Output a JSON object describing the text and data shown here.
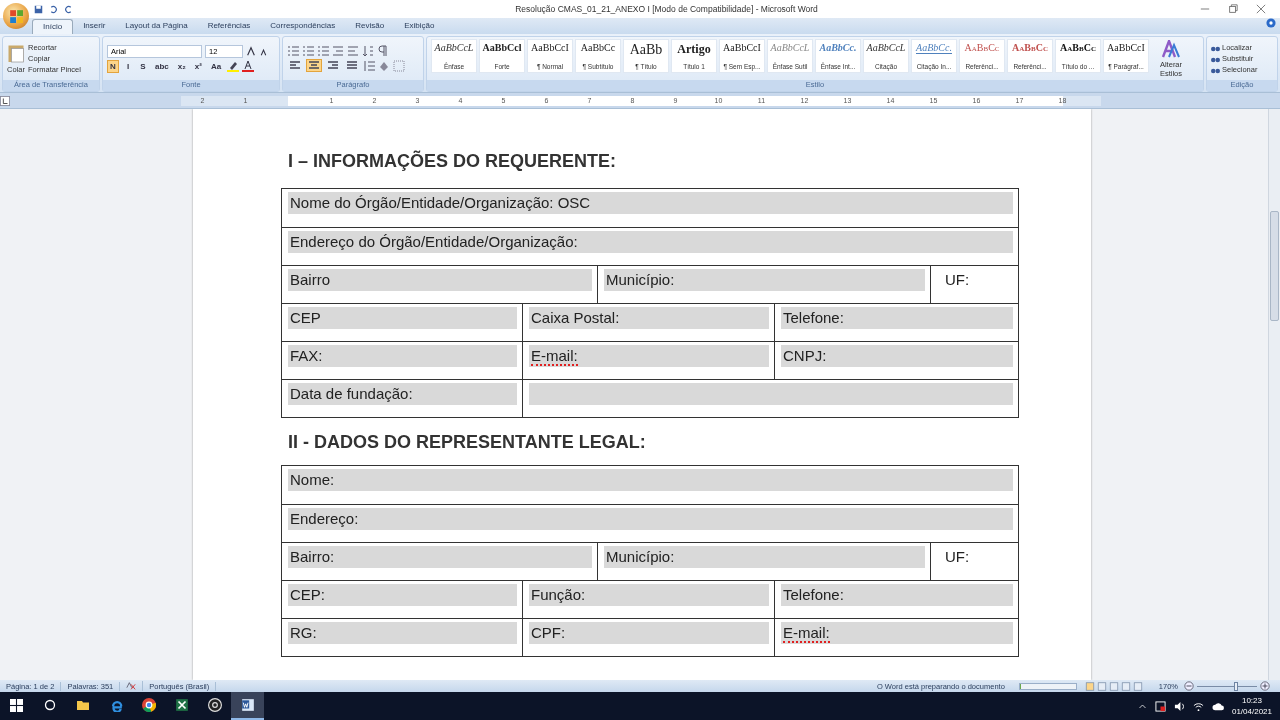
{
  "window": {
    "title": "Resolução CMAS_01_21_ANEXO I [Modo de Compatibilidade] - Microsoft Word"
  },
  "tabs": [
    {
      "label": "Início",
      "selected": true
    },
    {
      "label": "Inserir",
      "selected": false
    },
    {
      "label": "Layout da Página",
      "selected": false
    },
    {
      "label": "Referências",
      "selected": false
    },
    {
      "label": "Correspondências",
      "selected": false
    },
    {
      "label": "Revisão",
      "selected": false
    },
    {
      "label": "Exibição",
      "selected": false
    }
  ],
  "ribbon": {
    "clipboard": {
      "group": "Área de Transferência",
      "paste": "Colar",
      "items": [
        "Recortar",
        "Copiar",
        "Formatar Pincel"
      ]
    },
    "font": {
      "group": "Fonte",
      "family": "Arial",
      "size": "12",
      "buttons": [
        {
          "label": "N",
          "selected": true
        },
        {
          "label": "I",
          "selected": false
        },
        {
          "label": "S",
          "selected": false
        },
        {
          "label": "abc",
          "selected": false
        },
        {
          "label": "x₂",
          "selected": false
        },
        {
          "label": "x²",
          "selected": false
        },
        {
          "label": "Aa",
          "selected": false
        }
      ]
    },
    "paragraph": {
      "group": "Parágrafo",
      "alignments": [
        {
          "selected": false
        },
        {
          "selected": true
        },
        {
          "selected": false
        },
        {
          "selected": false
        }
      ]
    },
    "styles": {
      "group": "Estilo",
      "items": [
        {
          "preview": "AaBbCcL",
          "name": "Ênfase",
          "kind": "italic"
        },
        {
          "preview": "AaBbCcl",
          "name": "Forte",
          "kind": "bold"
        },
        {
          "preview": "AaBbCcI",
          "name": "¶ Normal",
          "kind": "plain"
        },
        {
          "preview": "AaBbCc",
          "name": "¶ Subtítulo",
          "kind": "plain"
        },
        {
          "preview": "AaBb",
          "name": "¶ Título",
          "kind": "large"
        },
        {
          "preview": "Artigo",
          "name": "Título 1",
          "kind": "heading"
        },
        {
          "preview": "AaBbCcI",
          "name": "¶ Sem Esp...",
          "kind": "plain"
        },
        {
          "preview": "AaBbCcL",
          "name": "Ênfase Sutil",
          "kind": "subtle"
        },
        {
          "preview": "AaBbCc.",
          "name": "Ênfase Int...",
          "kind": "intense"
        },
        {
          "preview": "AaBbCcL",
          "name": "Citação",
          "kind": "italic"
        },
        {
          "preview": "AaBbCc.",
          "name": "Citação In...",
          "kind": "quote"
        },
        {
          "preview": "AaBbCc",
          "name": "Referênci...",
          "kind": "reference"
        },
        {
          "preview": "AaBbCc",
          "name": "Referênci...",
          "kind": "strong-reference"
        },
        {
          "preview": "AaBbCc",
          "name": "Título do ...",
          "kind": "book"
        },
        {
          "preview": "AaBbCcI",
          "name": "¶ Parágraf...",
          "kind": "plain"
        }
      ],
      "change": "Alterar Estilos"
    },
    "editing": {
      "group": "Edição",
      "items": [
        "Localizar",
        "Substituir",
        "Selecionar"
      ]
    }
  },
  "ruler": {
    "left_numbers": [
      "2",
      "1"
    ],
    "right_numbers": [
      "1",
      "2",
      "3",
      "4",
      "5",
      "6",
      "7",
      "8",
      "9",
      "10",
      "11",
      "12",
      "13",
      "14",
      "15",
      "16",
      "17",
      "18"
    ]
  },
  "document": {
    "sections": [
      {
        "title": "I – INFORMAÇÕES DO REQUERENTE:",
        "rows": [
          {
            "kind": "full",
            "cells": [
              {
                "label": "Nome do Órgão/Entidade/Organização: OSC",
                "shaded": true,
                "misspelled": false
              }
            ]
          },
          {
            "kind": "full",
            "cells": [
              {
                "label": "Endereço do Órgão/Entidade/Organização:",
                "shaded": true,
                "misspelled": false
              }
            ]
          },
          {
            "kind": "address",
            "cells": [
              {
                "label": "Bairro",
                "shaded": true,
                "misspelled": false
              },
              {
                "label": "Município:",
                "shaded": true,
                "misspelled": false
              },
              {
                "label": "UF:",
                "shaded": false,
                "misspelled": false
              }
            ]
          },
          {
            "kind": "thirds",
            "cells": [
              {
                "label": "CEP",
                "shaded": true,
                "misspelled": false
              },
              {
                "label": "Caixa Postal:",
                "shaded": true,
                "misspelled": false
              },
              {
                "label": "Telefone:",
                "shaded": true,
                "misspelled": false
              }
            ]
          },
          {
            "kind": "thirds",
            "cells": [
              {
                "label": "FAX:",
                "shaded": true,
                "misspelled": false
              },
              {
                "label": "E-mail:",
                "shaded": true,
                "misspelled": true
              },
              {
                "label": "CNPJ:",
                "shaded": true,
                "misspelled": false
              }
            ]
          },
          {
            "kind": "split",
            "cells": [
              {
                "label": "Data de fundação:",
                "shaded": true,
                "misspelled": false
              },
              {
                "shaded": true
              }
            ]
          }
        ]
      },
      {
        "title": "II - DADOS DO REPRESENTANTE LEGAL:",
        "rows": [
          {
            "kind": "full",
            "cells": [
              {
                "label": "Nome:",
                "shaded": true,
                "misspelled": false
              }
            ]
          },
          {
            "kind": "full",
            "cells": [
              {
                "label": "Endereço:",
                "shaded": true,
                "misspelled": false
              }
            ]
          },
          {
            "kind": "address",
            "cells": [
              {
                "label": "Bairro:",
                "shaded": true,
                "misspelled": false
              },
              {
                "label": "Município:",
                "shaded": true,
                "misspelled": false
              },
              {
                "label": "UF:",
                "shaded": false,
                "misspelled": false
              }
            ]
          },
          {
            "kind": "thirds",
            "cells": [
              {
                "label": "CEP:",
                "shaded": true,
                "misspelled": false
              },
              {
                "label": "Função:",
                "shaded": true,
                "misspelled": false
              },
              {
                "label": "Telefone:",
                "shaded": true,
                "misspelled": false
              }
            ]
          },
          {
            "kind": "thirds",
            "cells": [
              {
                "label": "RG:",
                "shaded": true,
                "misspelled": false
              },
              {
                "label": "CPF:",
                "shaded": true,
                "misspelled": false
              },
              {
                "label": "E-mail:",
                "shaded": true,
                "misspelled": true
              }
            ]
          }
        ]
      }
    ]
  },
  "status_bar": {
    "page": "Página: 1 de 2",
    "words": "Palavras: 351",
    "language": "Português (Brasil)",
    "message": "O Word está preparando o documento",
    "progress": {
      "level": 0
    },
    "zoom": "170%",
    "zoom_slider": {
      "level": 0.66
    }
  },
  "taskbar": {
    "apps": [
      {
        "kind": "start",
        "selected": false
      },
      {
        "kind": "search",
        "selected": false
      },
      {
        "kind": "folder",
        "selected": false
      },
      {
        "kind": "edge",
        "selected": false
      },
      {
        "kind": "chrome",
        "selected": false
      },
      {
        "kind": "excel",
        "selected": false
      },
      {
        "kind": "obs",
        "selected": false
      },
      {
        "kind": "word",
        "selected": true
      }
    ],
    "time": "10:23",
    "date": "01/04/2021"
  }
}
